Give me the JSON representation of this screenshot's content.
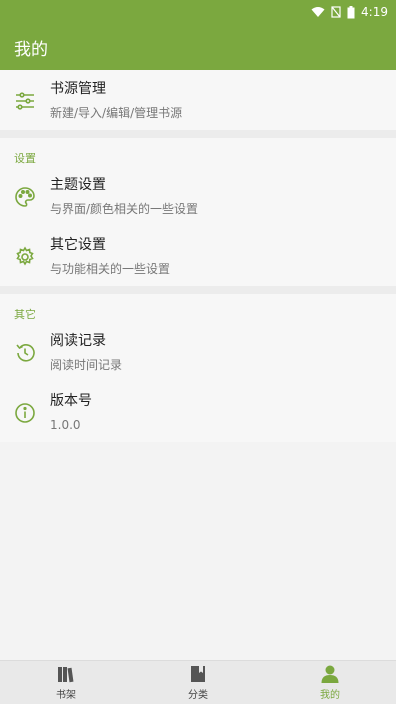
{
  "status_bar": {
    "time": "4:19",
    "icons": [
      "wifi-icon",
      "signal-off-icon",
      "battery-icon"
    ]
  },
  "app_bar": {
    "title": "我的"
  },
  "source": {
    "title": "书源管理",
    "subtitle": "新建/导入/编辑/管理书源",
    "icon": "sliders-icon"
  },
  "settings_section": {
    "header": "设置",
    "items": [
      {
        "title": "主题设置",
        "subtitle": "与界面/颜色相关的一些设置",
        "icon": "palette-icon"
      },
      {
        "title": "其它设置",
        "subtitle": "与功能相关的一些设置",
        "icon": "gear-icon"
      }
    ]
  },
  "other_section": {
    "header": "其它",
    "items": [
      {
        "title": "阅读记录",
        "subtitle": "阅读时间记录",
        "icon": "history-icon"
      },
      {
        "title": "版本号",
        "subtitle": "1.0.0",
        "icon": "info-icon"
      }
    ]
  },
  "bottom_nav": {
    "items": [
      {
        "label": "书架",
        "icon": "bookshelf-icon"
      },
      {
        "label": "分类",
        "icon": "book-icon"
      },
      {
        "label": "我的",
        "icon": "person-icon",
        "active": true
      }
    ]
  },
  "colors": {
    "accent": "#7ba83f",
    "background": "#f3f3f3",
    "divider": "#ececec"
  }
}
